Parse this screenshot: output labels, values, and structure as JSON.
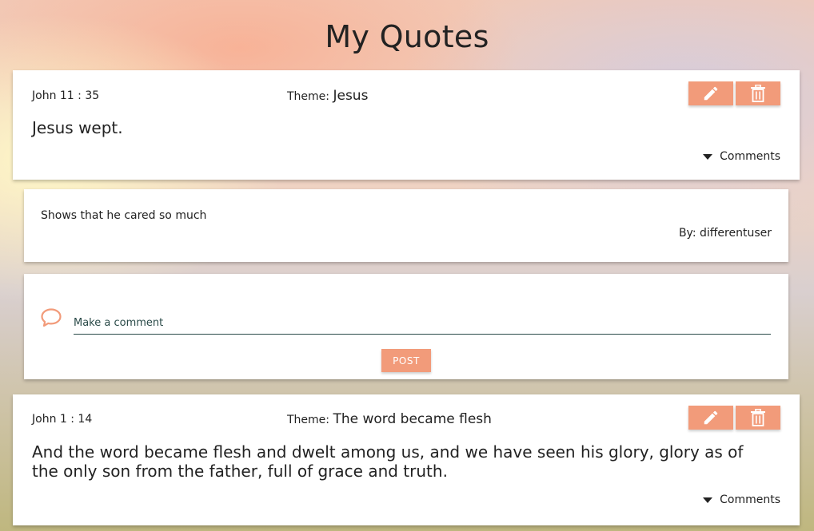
{
  "page": {
    "title": "My Quotes"
  },
  "colors": {
    "accent": "#f29b7a",
    "input_line": "#2a4a48"
  },
  "quotes": [
    {
      "reference": "John 11 : 35",
      "theme_label": "Theme:",
      "theme": "Jesus",
      "text": "Jesus wept.",
      "comments_label": "Comments",
      "edit_icon": "pencil-icon",
      "delete_icon": "trash-icon"
    },
    {
      "reference": "John 1 : 14",
      "theme_label": "Theme:",
      "theme": "The word became flesh",
      "text": "And the word became flesh and dwelt among us, and we have seen his glory, glory as of the only son from the father, full of grace and truth.",
      "comments_label": "Comments",
      "edit_icon": "pencil-icon",
      "delete_icon": "trash-icon"
    }
  ],
  "comments": [
    {
      "text": "Shows that he cared so much",
      "author": "By: differentuser"
    }
  ],
  "new_comment": {
    "icon": "speech-bubble-icon",
    "placeholder": "Make a comment",
    "value": "",
    "post_label": "POST"
  }
}
